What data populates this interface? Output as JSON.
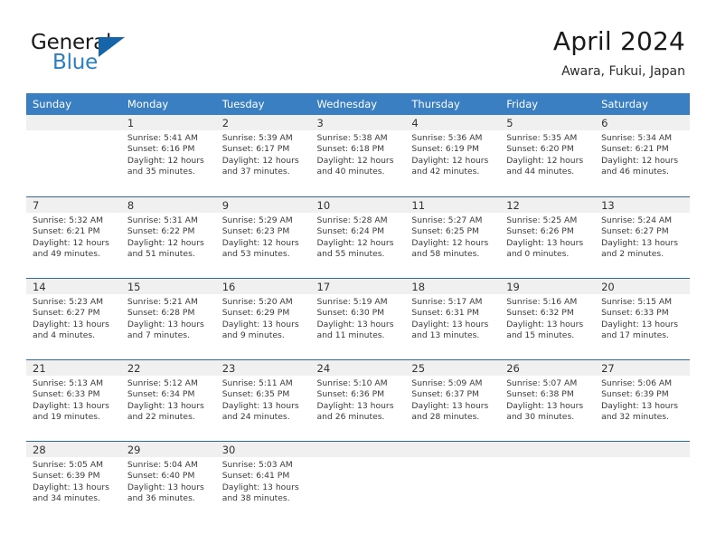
{
  "brand": {
    "word1": "General",
    "word2": "Blue",
    "flag_icon": "triangle-flag-icon",
    "accent_color": "#1565a8"
  },
  "header": {
    "title": "April 2024",
    "subtitle": "Awara, Fukui, Japan"
  },
  "theme": {
    "header_row_bg": "#3a7fc1",
    "daynum_band_bg": "#f0f0f0",
    "week_separator": "#2e6da4"
  },
  "weekday_headers": [
    "Sunday",
    "Monday",
    "Tuesday",
    "Wednesday",
    "Thursday",
    "Friday",
    "Saturday"
  ],
  "weeks": [
    [
      {
        "day": "",
        "sunrise": "",
        "sunset": "",
        "daylight_line1": "",
        "daylight_line2": "",
        "empty": true
      },
      {
        "day": "1",
        "sunrise": "Sunrise: 5:41 AM",
        "sunset": "Sunset: 6:16 PM",
        "daylight_line1": "Daylight: 12 hours",
        "daylight_line2": "and 35 minutes."
      },
      {
        "day": "2",
        "sunrise": "Sunrise: 5:39 AM",
        "sunset": "Sunset: 6:17 PM",
        "daylight_line1": "Daylight: 12 hours",
        "daylight_line2": "and 37 minutes."
      },
      {
        "day": "3",
        "sunrise": "Sunrise: 5:38 AM",
        "sunset": "Sunset: 6:18 PM",
        "daylight_line1": "Daylight: 12 hours",
        "daylight_line2": "and 40 minutes."
      },
      {
        "day": "4",
        "sunrise": "Sunrise: 5:36 AM",
        "sunset": "Sunset: 6:19 PM",
        "daylight_line1": "Daylight: 12 hours",
        "daylight_line2": "and 42 minutes."
      },
      {
        "day": "5",
        "sunrise": "Sunrise: 5:35 AM",
        "sunset": "Sunset: 6:20 PM",
        "daylight_line1": "Daylight: 12 hours",
        "daylight_line2": "and 44 minutes."
      },
      {
        "day": "6",
        "sunrise": "Sunrise: 5:34 AM",
        "sunset": "Sunset: 6:21 PM",
        "daylight_line1": "Daylight: 12 hours",
        "daylight_line2": "and 46 minutes."
      }
    ],
    [
      {
        "day": "7",
        "sunrise": "Sunrise: 5:32 AM",
        "sunset": "Sunset: 6:21 PM",
        "daylight_line1": "Daylight: 12 hours",
        "daylight_line2": "and 49 minutes."
      },
      {
        "day": "8",
        "sunrise": "Sunrise: 5:31 AM",
        "sunset": "Sunset: 6:22 PM",
        "daylight_line1": "Daylight: 12 hours",
        "daylight_line2": "and 51 minutes."
      },
      {
        "day": "9",
        "sunrise": "Sunrise: 5:29 AM",
        "sunset": "Sunset: 6:23 PM",
        "daylight_line1": "Daylight: 12 hours",
        "daylight_line2": "and 53 minutes."
      },
      {
        "day": "10",
        "sunrise": "Sunrise: 5:28 AM",
        "sunset": "Sunset: 6:24 PM",
        "daylight_line1": "Daylight: 12 hours",
        "daylight_line2": "and 55 minutes."
      },
      {
        "day": "11",
        "sunrise": "Sunrise: 5:27 AM",
        "sunset": "Sunset: 6:25 PM",
        "daylight_line1": "Daylight: 12 hours",
        "daylight_line2": "and 58 minutes."
      },
      {
        "day": "12",
        "sunrise": "Sunrise: 5:25 AM",
        "sunset": "Sunset: 6:26 PM",
        "daylight_line1": "Daylight: 13 hours",
        "daylight_line2": "and 0 minutes."
      },
      {
        "day": "13",
        "sunrise": "Sunrise: 5:24 AM",
        "sunset": "Sunset: 6:27 PM",
        "daylight_line1": "Daylight: 13 hours",
        "daylight_line2": "and 2 minutes."
      }
    ],
    [
      {
        "day": "14",
        "sunrise": "Sunrise: 5:23 AM",
        "sunset": "Sunset: 6:27 PM",
        "daylight_line1": "Daylight: 13 hours",
        "daylight_line2": "and 4 minutes."
      },
      {
        "day": "15",
        "sunrise": "Sunrise: 5:21 AM",
        "sunset": "Sunset: 6:28 PM",
        "daylight_line1": "Daylight: 13 hours",
        "daylight_line2": "and 7 minutes."
      },
      {
        "day": "16",
        "sunrise": "Sunrise: 5:20 AM",
        "sunset": "Sunset: 6:29 PM",
        "daylight_line1": "Daylight: 13 hours",
        "daylight_line2": "and 9 minutes."
      },
      {
        "day": "17",
        "sunrise": "Sunrise: 5:19 AM",
        "sunset": "Sunset: 6:30 PM",
        "daylight_line1": "Daylight: 13 hours",
        "daylight_line2": "and 11 minutes."
      },
      {
        "day": "18",
        "sunrise": "Sunrise: 5:17 AM",
        "sunset": "Sunset: 6:31 PM",
        "daylight_line1": "Daylight: 13 hours",
        "daylight_line2": "and 13 minutes."
      },
      {
        "day": "19",
        "sunrise": "Sunrise: 5:16 AM",
        "sunset": "Sunset: 6:32 PM",
        "daylight_line1": "Daylight: 13 hours",
        "daylight_line2": "and 15 minutes."
      },
      {
        "day": "20",
        "sunrise": "Sunrise: 5:15 AM",
        "sunset": "Sunset: 6:33 PM",
        "daylight_line1": "Daylight: 13 hours",
        "daylight_line2": "and 17 minutes."
      }
    ],
    [
      {
        "day": "21",
        "sunrise": "Sunrise: 5:13 AM",
        "sunset": "Sunset: 6:33 PM",
        "daylight_line1": "Daylight: 13 hours",
        "daylight_line2": "and 19 minutes."
      },
      {
        "day": "22",
        "sunrise": "Sunrise: 5:12 AM",
        "sunset": "Sunset: 6:34 PM",
        "daylight_line1": "Daylight: 13 hours",
        "daylight_line2": "and 22 minutes."
      },
      {
        "day": "23",
        "sunrise": "Sunrise: 5:11 AM",
        "sunset": "Sunset: 6:35 PM",
        "daylight_line1": "Daylight: 13 hours",
        "daylight_line2": "and 24 minutes."
      },
      {
        "day": "24",
        "sunrise": "Sunrise: 5:10 AM",
        "sunset": "Sunset: 6:36 PM",
        "daylight_line1": "Daylight: 13 hours",
        "daylight_line2": "and 26 minutes."
      },
      {
        "day": "25",
        "sunrise": "Sunrise: 5:09 AM",
        "sunset": "Sunset: 6:37 PM",
        "daylight_line1": "Daylight: 13 hours",
        "daylight_line2": "and 28 minutes."
      },
      {
        "day": "26",
        "sunrise": "Sunrise: 5:07 AM",
        "sunset": "Sunset: 6:38 PM",
        "daylight_line1": "Daylight: 13 hours",
        "daylight_line2": "and 30 minutes."
      },
      {
        "day": "27",
        "sunrise": "Sunrise: 5:06 AM",
        "sunset": "Sunset: 6:39 PM",
        "daylight_line1": "Daylight: 13 hours",
        "daylight_line2": "and 32 minutes."
      }
    ],
    [
      {
        "day": "28",
        "sunrise": "Sunrise: 5:05 AM",
        "sunset": "Sunset: 6:39 PM",
        "daylight_line1": "Daylight: 13 hours",
        "daylight_line2": "and 34 minutes."
      },
      {
        "day": "29",
        "sunrise": "Sunrise: 5:04 AM",
        "sunset": "Sunset: 6:40 PM",
        "daylight_line1": "Daylight: 13 hours",
        "daylight_line2": "and 36 minutes."
      },
      {
        "day": "30",
        "sunrise": "Sunrise: 5:03 AM",
        "sunset": "Sunset: 6:41 PM",
        "daylight_line1": "Daylight: 13 hours",
        "daylight_line2": "and 38 minutes."
      },
      {
        "day": "",
        "sunrise": "",
        "sunset": "",
        "daylight_line1": "",
        "daylight_line2": "",
        "empty": true
      },
      {
        "day": "",
        "sunrise": "",
        "sunset": "",
        "daylight_line1": "",
        "daylight_line2": "",
        "empty": true
      },
      {
        "day": "",
        "sunrise": "",
        "sunset": "",
        "daylight_line1": "",
        "daylight_line2": "",
        "empty": true
      },
      {
        "day": "",
        "sunrise": "",
        "sunset": "",
        "daylight_line1": "",
        "daylight_line2": "",
        "empty": true
      }
    ]
  ]
}
